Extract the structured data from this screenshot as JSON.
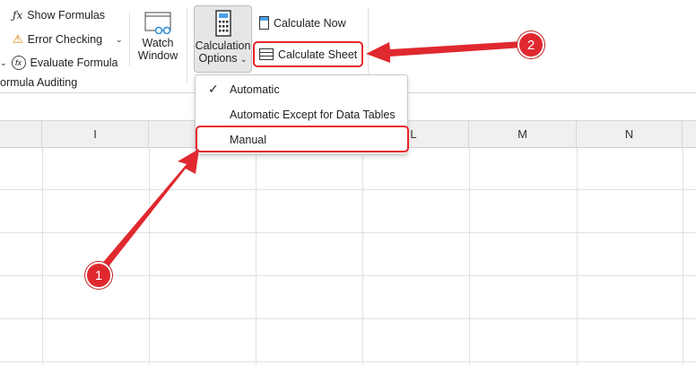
{
  "ribbon": {
    "show_formulas": "Show Formulas",
    "error_checking": "Error Checking",
    "evaluate_formula": "Evaluate Formula",
    "group_label": "ormula Auditing",
    "watch_line1": "Watch",
    "watch_line2": "Window",
    "calc_options_line1": "Calculation",
    "calc_options_line2": "Options",
    "calculate_now": "Calculate Now",
    "calculate_sheet": "Calculate Sheet"
  },
  "menu": {
    "items": [
      {
        "label": "Automatic",
        "checked": true
      },
      {
        "label": "Automatic Except for Data Tables",
        "checked": false
      },
      {
        "label": "Manual",
        "checked": false
      }
    ]
  },
  "columns": [
    "I",
    "",
    "",
    "L",
    "M",
    "N"
  ],
  "annotations": {
    "badge1": "1",
    "badge2": "2",
    "accent": "#e0282f"
  }
}
